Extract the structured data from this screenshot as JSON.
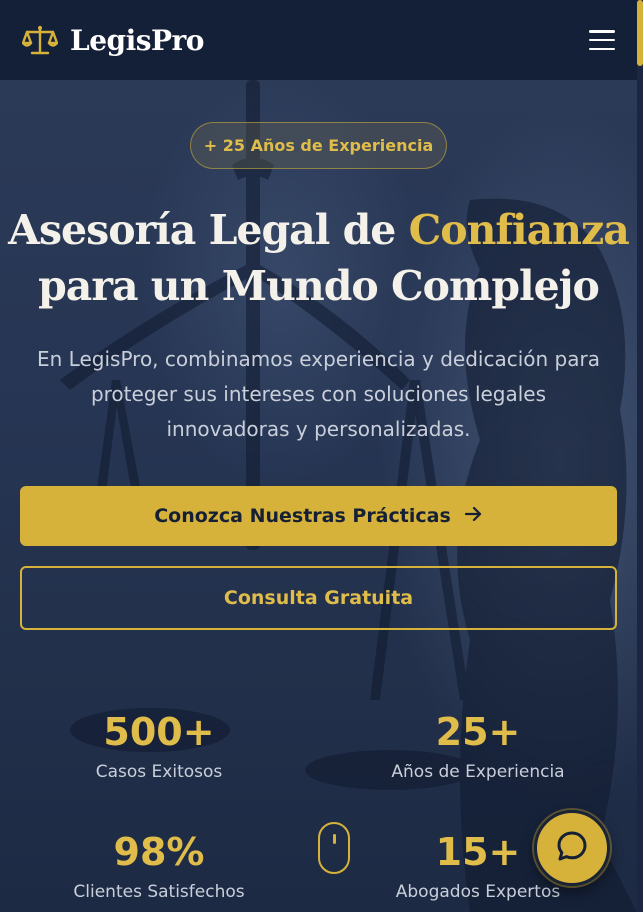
{
  "header": {
    "brand_name": "LegisPro",
    "logo_icon": "scales-of-justice-icon",
    "menu_icon": "hamburger-menu-icon"
  },
  "hero": {
    "badge": "+ 25 Años de Experiencia",
    "headline_part1": "Asesoría Legal de ",
    "headline_accent": "Confianza",
    "headline_part2": "para un Mundo Complejo",
    "subtitle": "En LegisPro, combinamos experiencia y dedicación para proteger sus intereses con soluciones legales innovadoras y personalizadas.",
    "primary_button": "Conozca Nuestras Prácticas",
    "primary_button_icon": "arrow-right-icon",
    "secondary_button": "Consulta Gratuita"
  },
  "stats": [
    {
      "value": "500+",
      "label": "Casos Exitosos"
    },
    {
      "value": "25+",
      "label": "Años de Experiencia"
    },
    {
      "value": "98%",
      "label": "Clientes Satisfechos"
    },
    {
      "value": "15+",
      "label": "Abogados Expertos"
    }
  ],
  "scroll_indicator_icon": "mouse-scroll-icon",
  "chat_icon": "chat-bubble-icon",
  "colors": {
    "accent": "#d6b23a",
    "navy": "#142038",
    "text_light": "#c9cfda"
  }
}
